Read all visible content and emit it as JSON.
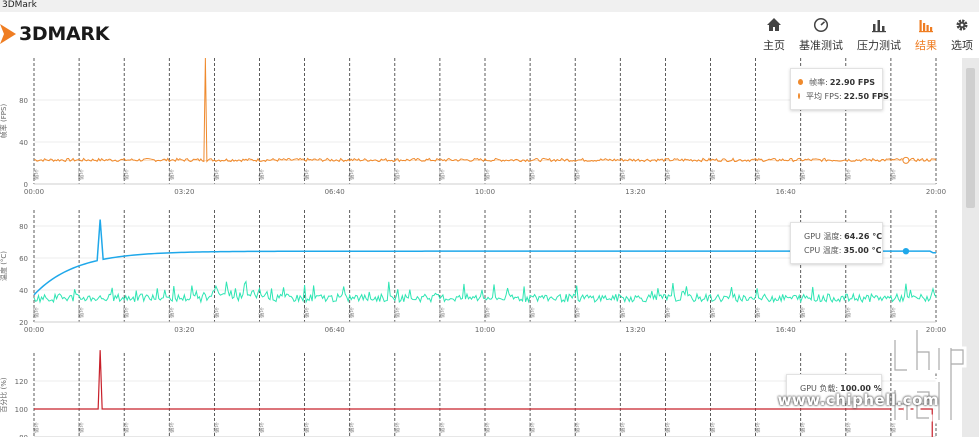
{
  "window": {
    "title": "3DMark"
  },
  "app": {
    "logo_text": "3DMARK"
  },
  "nav": {
    "items": [
      {
        "label": "主页",
        "icon": "home-icon"
      },
      {
        "label": "基准测试",
        "icon": "gauge-icon"
      },
      {
        "label": "压力测试",
        "icon": "bar-chart-icon"
      },
      {
        "label": "结果",
        "icon": "results-chart-icon",
        "active": true
      },
      {
        "label": "选项",
        "icon": "gear-icon"
      }
    ]
  },
  "colors": {
    "accent": "#ef7d22",
    "fps": "#ef8a2d",
    "gpu_temp": "#1fa8ea",
    "cpu_temp": "#2ee5b3",
    "gpu_load": "#c8202a"
  },
  "charts": {
    "fps": {
      "ylabel": "帧率 (FPS)",
      "legend": [
        {
          "name": "帧率:",
          "value": "22.90 FPS"
        },
        {
          "name": "平均 FPS:",
          "value": "22.50 FPS"
        }
      ]
    },
    "temp": {
      "ylabel": "温度 (°C)",
      "legend": [
        {
          "name": "GPU 温度:",
          "value": "64.26 °C"
        },
        {
          "name": "CPU 温度:",
          "value": "35.00 °C"
        }
      ]
    },
    "load": {
      "ylabel": "百分比 (%)",
      "legend": [
        {
          "name": "GPU 负载:",
          "value": "100.00 %"
        }
      ]
    }
  },
  "marker_label": "循环",
  "watermark": "www.chiphell.com",
  "chart_data": [
    {
      "type": "line",
      "ylabel": "帧率 (FPS)",
      "ylim": [
        0,
        120
      ],
      "yticks": [
        0,
        40,
        80
      ],
      "xlim": [
        0,
        1200
      ],
      "xticks": [
        "00:00",
        "03:20",
        "06:40",
        "10:00",
        "13:20",
        "16:40",
        "20:00"
      ],
      "series": [
        {
          "name": "帧率",
          "baseline": 22.9,
          "spike": {
            "t": 228,
            "value": 120
          }
        },
        {
          "name": "平均 FPS",
          "value": 22.5
        }
      ],
      "grid": true
    },
    {
      "type": "line",
      "ylabel": "温度 (°C)",
      "ylim": [
        20,
        90
      ],
      "yticks": [
        20,
        40,
        60,
        80
      ],
      "xlim": [
        0,
        1200
      ],
      "xticks": [
        "00:00",
        "03:20",
        "06:40",
        "10:00",
        "13:20",
        "16:40",
        "20:00"
      ],
      "series": [
        {
          "name": "GPU 温度",
          "start": 37,
          "plateau": 64.26,
          "spike": {
            "t": 88,
            "value": 84
          }
        },
        {
          "name": "CPU 温度",
          "baseline": 35.0,
          "range": [
            30,
            46
          ]
        }
      ],
      "grid": true
    },
    {
      "type": "line",
      "ylabel": "百分比 (%)",
      "ylim": [
        80,
        140
      ],
      "yticks": [
        80,
        100,
        120
      ],
      "xlim": [
        0,
        1200
      ],
      "xticks": [],
      "series": [
        {
          "name": "GPU 负载",
          "value": 100.0,
          "spike": {
            "t": 88,
            "value": 142
          }
        }
      ],
      "grid": true
    }
  ]
}
